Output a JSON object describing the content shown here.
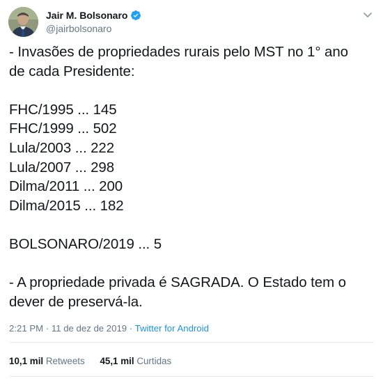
{
  "author": {
    "display_name": "Jair M. Bolsonaro",
    "handle": "@jairbolsonaro",
    "verified_icon": "verified-badge-icon",
    "avatar_icon": "avatar-photo"
  },
  "tweet": {
    "lines": [
      "- Invasões de propriedades rurais pelo MST no 1° ano",
      "de cada Presidente:",
      "",
      "FHC/1995 ... 145",
      "FHC/1999 ... 502",
      "Lula/2003 ... 222",
      "Lula/2007 ... 298",
      "Dilma/2011 ... 200",
      "Dilma/2015 ... 182",
      "",
      "BOLSONARO/2019 ... 5",
      "",
      "- A propriedade privada é SAGRADA. O Estado tem o",
      "dever de preservá-la."
    ]
  },
  "meta": {
    "time": "2:21 PM",
    "separator": " · ",
    "date": "11 de dez de 2019",
    "source": "Twitter for Android"
  },
  "stats": {
    "retweets_count": "10,1 mil",
    "retweets_label": "Retweets",
    "likes_count": "45,1 mil",
    "likes_label": "Curtidas"
  },
  "colors": {
    "text": "#14171a",
    "secondary": "#657786",
    "link": "#1b95e0",
    "divider": "#e6ecf0",
    "verified": "#1da1f2"
  }
}
